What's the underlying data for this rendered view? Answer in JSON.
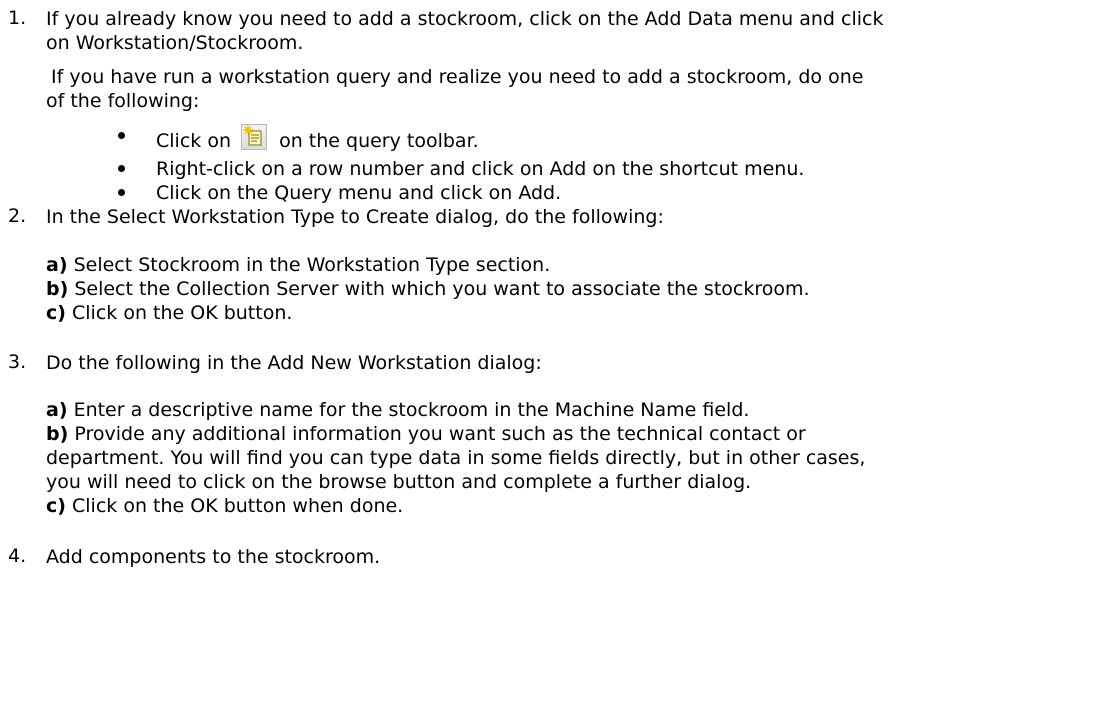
{
  "steps": {
    "s1": {
      "number": "1.",
      "line1": "If you already know you need to add a stockroom, click on the Add Data menu and click",
      "line2": "on Workstation/Stockroom.",
      "line3": "If you have run a workstation query and realize you need to add a stockroom, do one",
      "line4": "of the following:",
      "bullets": {
        "b1_before": "Click on",
        "b1_icon": "add-record-icon",
        "b1_after": "on the query toolbar.",
        "b2": "Right-click on a row number and click on Add on the shortcut menu.",
        "b3": "Click on the Query menu and click on Add."
      }
    },
    "s2": {
      "number": "2.",
      "text": "In the Select Workstation Type to Create dialog, do the following:",
      "a_label": "a)",
      "a_text": "Select Stockroom in the Workstation Type section.",
      "b_label": "b)",
      "b_text": "Select the Collection Server with which you want to associate the stockroom.",
      "c_label": "c)",
      "c_text": "Click on the OK button."
    },
    "s3": {
      "number": "3.",
      "text": "Do the following in the Add New Workstation dialog:",
      "a_label": "a)",
      "a_text": "Enter a descriptive name for the stockroom in the Machine Name field.",
      "b_label": "b)",
      "b_line1": "Provide any additional information you want such as the technical contact or",
      "b_line2": "department. You will find you can type data in some fields directly, but in other cases,",
      "b_line3": "you will need to click on the browse button and complete a further dialog.",
      "c_label": "c)",
      "c_text": "Click on the OK button when done."
    },
    "s4": {
      "number": "4.",
      "text": "Add components to the stockroom."
    }
  },
  "colors": {
    "text": "#000000",
    "background": "#ffffff",
    "icon_sparkle": "#f2c200",
    "icon_doc": "#fff8b0"
  }
}
